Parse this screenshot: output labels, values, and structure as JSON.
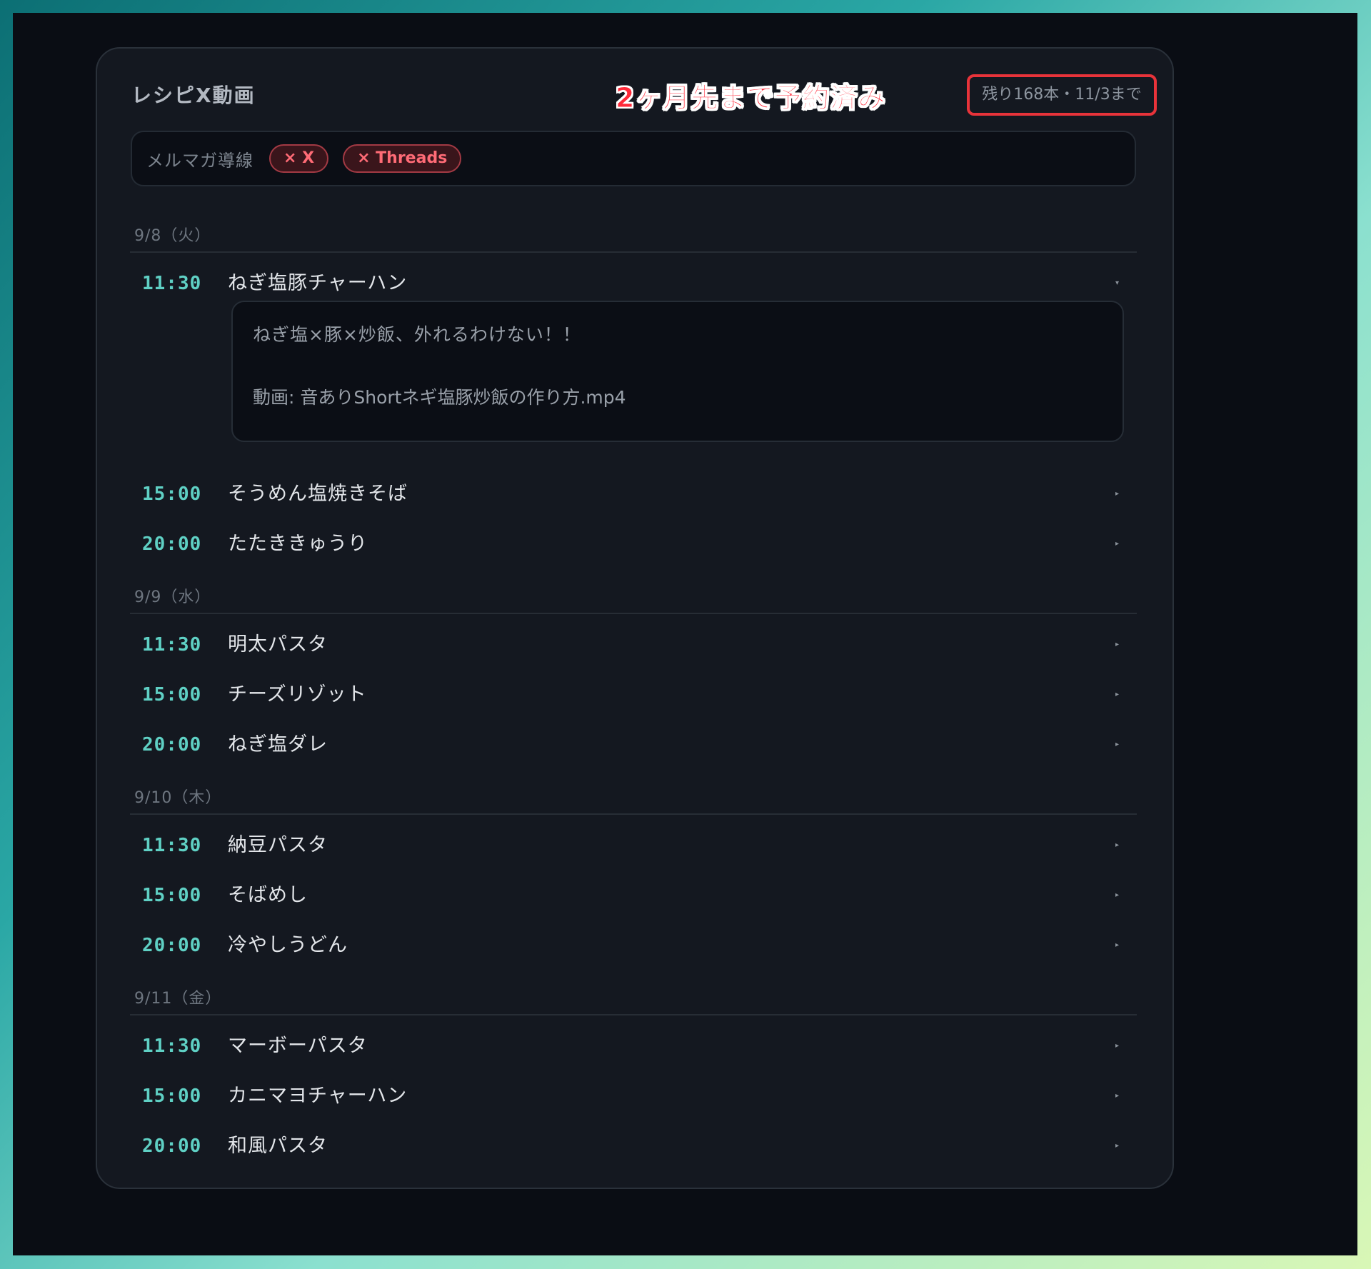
{
  "card": {
    "title": "レシピX動画",
    "annotation": "2ヶ月先まで予約済み",
    "remaining": "残り168本・11/3まで"
  },
  "filter": {
    "label": "メルマガ導線",
    "chips": [
      "× X",
      "× Threads"
    ]
  },
  "days": [
    {
      "date": "9/8（火）",
      "items": [
        {
          "time": "11:30",
          "name": "ねぎ塩豚チャーハン",
          "expanded": true,
          "caret": "▾"
        },
        {
          "time": "15:00",
          "name": "そうめん塩焼きそば",
          "caret": "▸"
        },
        {
          "time": "20:00",
          "name": "たたききゅうり",
          "caret": "▸"
        }
      ]
    },
    {
      "date": "9/9（水）",
      "items": [
        {
          "time": "11:30",
          "name": "明太パスタ",
          "caret": "▸"
        },
        {
          "time": "15:00",
          "name": "チーズリゾット",
          "caret": "▸"
        },
        {
          "time": "20:00",
          "name": "ねぎ塩ダレ",
          "caret": "▸"
        }
      ]
    },
    {
      "date": "9/10（木）",
      "items": [
        {
          "time": "11:30",
          "name": "納豆パスタ",
          "caret": "▸"
        },
        {
          "time": "15:00",
          "name": "そばめし",
          "caret": "▸"
        },
        {
          "time": "20:00",
          "name": "冷やしうどん",
          "caret": "▸"
        }
      ]
    },
    {
      "date": "9/11（金）",
      "items": [
        {
          "time": "11:30",
          "name": "マーボーパスタ",
          "caret": "▸"
        },
        {
          "time": "15:00",
          "name": "カニマヨチャーハン",
          "caret": "▸"
        },
        {
          "time": "20:00",
          "name": "和風パスタ",
          "caret": "▸"
        }
      ]
    }
  ],
  "detail": {
    "text": "ねぎ塩×豚×炒飯、外れるわけない！！",
    "video": "動画: 音ありShortネギ塩豚炒飯の作り方.mp4"
  },
  "colors": {
    "accent_time": "#5fd0c4",
    "chip_red": "#ff6b76",
    "highlight_box": "#e8333a"
  }
}
